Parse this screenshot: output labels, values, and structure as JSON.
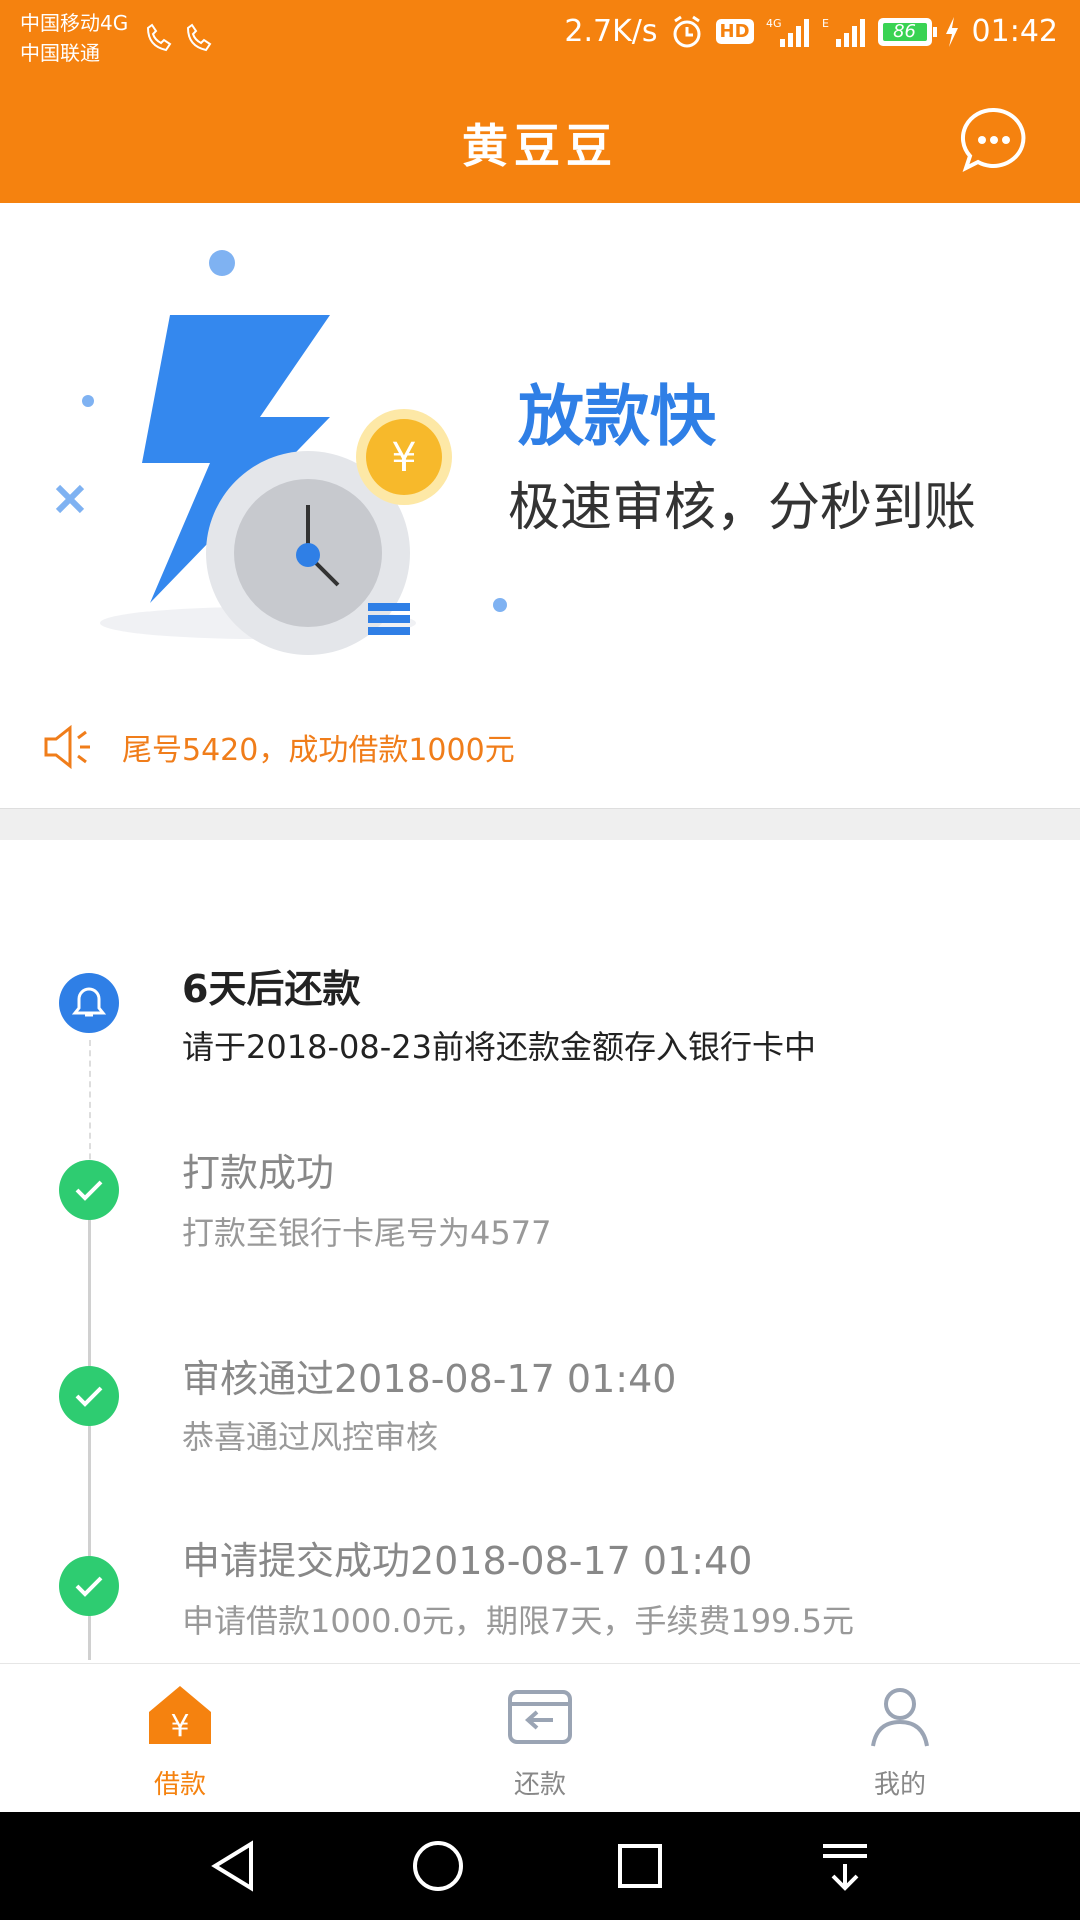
{
  "status_bar": {
    "carrier_1": "中国移动4G",
    "carrier_2": "中国联通",
    "net_speed": "2.7K/s",
    "hd": "HD",
    "battery": "86",
    "time": "01:42"
  },
  "header": {
    "title": "黄豆豆"
  },
  "banner": {
    "title": "放款快",
    "subtitle": "极速审核，分秒到账"
  },
  "notice": {
    "text": "尾号5420，成功借款1000元"
  },
  "timeline": [
    {
      "title": "6天后还款",
      "desc": "请于2018-08-23前将还款金额存入银行卡中",
      "state": "active"
    },
    {
      "title": "打款成功",
      "desc": "打款至银行卡尾号为4577",
      "state": "done"
    },
    {
      "title": "审核通过2018-08-17 01:40",
      "desc": "恭喜通过风控审核",
      "state": "done"
    },
    {
      "title": "申请提交成功2018-08-17 01:40",
      "desc": "申请借款1000.0元，期限7天，手续费199.5元",
      "state": "done"
    }
  ],
  "bottom_nav": [
    {
      "label": "借款",
      "icon": "loan-house-icon",
      "selected": true
    },
    {
      "label": "还款",
      "icon": "repay-card-icon",
      "selected": false
    },
    {
      "label": "我的",
      "icon": "profile-icon",
      "selected": false
    }
  ],
  "colors": {
    "brand_orange": "#f5820f",
    "accent_blue": "#2f7fe6",
    "success_green": "#2ecc71"
  }
}
